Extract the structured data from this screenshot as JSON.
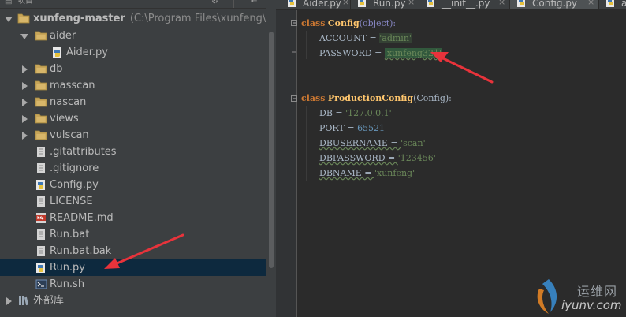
{
  "panel": {
    "header_label": "项目",
    "gear_glyph": "⚙",
    "hide_glyph": "⇤"
  },
  "tree": {
    "root": {
      "name": "xunfeng-master",
      "path": "(C:\\Program Files\\xunfeng\\xunfeng-"
    },
    "items": [
      {
        "label": "aider",
        "type": "folder"
      },
      {
        "label": "Aider.py",
        "type": "python-file"
      },
      {
        "label": "db",
        "type": "folder"
      },
      {
        "label": "masscan",
        "type": "folder"
      },
      {
        "label": "nascan",
        "type": "folder"
      },
      {
        "label": "views",
        "type": "folder"
      },
      {
        "label": "vulscan",
        "type": "folder"
      },
      {
        "label": ".gitattributes",
        "type": "text-file"
      },
      {
        "label": ".gitignore",
        "type": "text-file"
      },
      {
        "label": "Config.py",
        "type": "python-file"
      },
      {
        "label": "LICENSE",
        "type": "text-file"
      },
      {
        "label": "README.md",
        "type": "markdown-file"
      },
      {
        "label": "Run.bat",
        "type": "text-file"
      },
      {
        "label": "Run.bat.bak",
        "type": "text-file"
      },
      {
        "label": "Run.py",
        "type": "python-file",
        "selected": true
      },
      {
        "label": "Run.sh",
        "type": "shell-file"
      }
    ],
    "external_libraries": "外部库"
  },
  "tabs": [
    {
      "label": "Aider.py",
      "close": "×"
    },
    {
      "label": "Run.py",
      "close": "×"
    },
    {
      "label": "__init__.py",
      "close": "×"
    },
    {
      "label": "Config.py",
      "close": "×",
      "active": true
    },
    {
      "label": "ap",
      "close": ""
    }
  ],
  "code": {
    "class1_kw": "class",
    "class1_name": "Config",
    "class1_base": "(object):",
    "account_key": "ACCOUNT = ",
    "account_val": "'admin'",
    "password_key": "PASSWORD = ",
    "password_val": "'xunfeng321'",
    "class2_kw": "class",
    "class2_name": "ProductionConfig",
    "class2_base": "(Config):",
    "db_key": "DB = ",
    "db_val": "'127.0.0.1'",
    "port_key": "PORT = ",
    "port_val": "65521",
    "dbuser_key": "DBUSERNAME = ",
    "dbuser_val": "'scan'",
    "dbpass_key": "DBPASSWORD = ",
    "dbpass_val": "'123456'",
    "dbname_key": "DBNAME = ",
    "dbname_val": "'xunfeng'"
  },
  "watermark": {
    "top": "运维网",
    "bottom": "iyunv.com"
  },
  "colors": {
    "annotation_arrow": "#e8333b",
    "selection": "#0d293e",
    "keyword": "#cc7832",
    "string": "#6a8759",
    "number": "#6897bb"
  }
}
